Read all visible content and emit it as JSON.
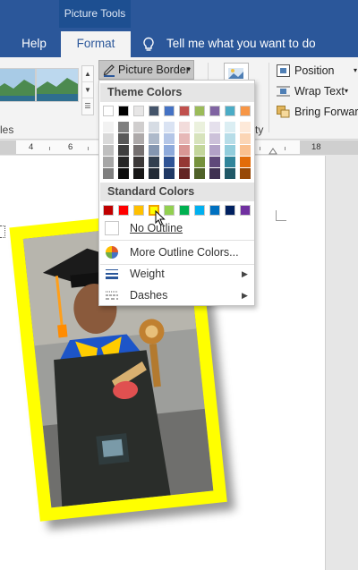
{
  "ribbon": {
    "context_group": "Picture Tools",
    "tabs": {
      "help": "Help",
      "format": "Format"
    },
    "tell_me": "Tell me what you want to do",
    "picture_styles_label": "les",
    "picture_border_button": "Picture Border",
    "arrange_label": "ty",
    "position": "Position",
    "wrap_text": "Wrap Text",
    "bring_forward": "Bring Forward"
  },
  "ruler": {
    "numbers": [
      "4",
      "6",
      "18"
    ]
  },
  "dropdown": {
    "theme_colors_header": "Theme Colors",
    "standard_colors_header": "Standard Colors",
    "theme_colors_top": [
      "#ffffff",
      "#000000",
      "#e7e6e6",
      "#44546a",
      "#4472c4",
      "#c0504d",
      "#9bbb59",
      "#8064a2",
      "#4bacc6",
      "#f79646"
    ],
    "theme_shades": [
      [
        "#f2f2f2",
        "#7f7f7f",
        "#d0cece",
        "#d6dce4",
        "#dae3f3",
        "#f2dcdb",
        "#ebf1dd",
        "#e5e0ec",
        "#dbeef3",
        "#fde9d9"
      ],
      [
        "#d9d9d9",
        "#595959",
        "#aeaaaa",
        "#adb9ca",
        "#b4c6e7",
        "#e6b8b7",
        "#d7e3bc",
        "#ccc1d9",
        "#b7dde8",
        "#fbd5b5"
      ],
      [
        "#bfbfbf",
        "#3f3f3f",
        "#757070",
        "#8496b0",
        "#8eaadb",
        "#d99694",
        "#c3d69b",
        "#b2a2c7",
        "#92cddc",
        "#fac08f"
      ],
      [
        "#a6a6a6",
        "#262626",
        "#3b3838",
        "#323f4f",
        "#2f5496",
        "#953734",
        "#76923c",
        "#5f497a",
        "#31859b",
        "#e36c09"
      ],
      [
        "#7f7f7f",
        "#0c0c0c",
        "#171616",
        "#222a35",
        "#1f3864",
        "#632423",
        "#4f6128",
        "#3f3151",
        "#205867",
        "#974806"
      ]
    ],
    "standard_colors": [
      "#c00000",
      "#ff0000",
      "#ffc000",
      "#ffff00",
      "#92d050",
      "#00b050",
      "#00b0f0",
      "#0070c0",
      "#002060",
      "#7030a0"
    ],
    "items": {
      "no_outline": "No Outline",
      "more_outline_colors": "More Outline Colors...",
      "weight": "Weight",
      "dashes": "Dashes"
    }
  },
  "colors": {
    "ribbon_blue": "#2b579a",
    "frame_yellow": "#ffff00"
  }
}
